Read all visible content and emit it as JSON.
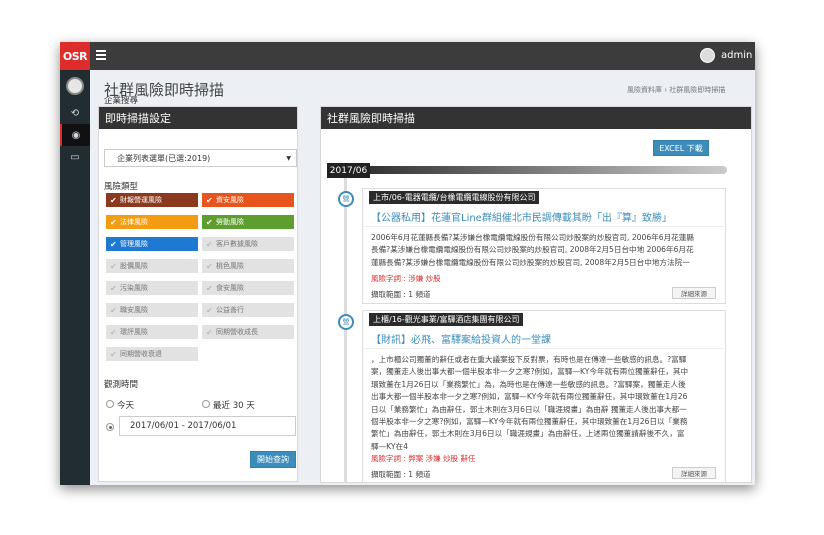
{
  "topbar": {
    "logo": "OSR",
    "user_name": "admin"
  },
  "page": {
    "title": "社群風險即時掃描",
    "breadcrumb": "風險資料庫 › 社群風險即時掃描"
  },
  "left_panel": {
    "header": "即時掃描設定",
    "company_label": "企業搜尋",
    "company_select": "企業列表選單(已選:2019)",
    "risk_type_label": "風險類型",
    "risk_types": [
      {
        "label": "財報營運風險",
        "on": true,
        "color": "#8b3a1f"
      },
      {
        "label": "資安風險",
        "on": true,
        "color": "#e8541d"
      },
      {
        "label": "法律風險",
        "on": true,
        "color": "#f39c12"
      },
      {
        "label": "勞動風險",
        "on": true,
        "color": "#5d9e2f"
      },
      {
        "label": "管理風險",
        "on": true,
        "color": "#1f78d1"
      },
      {
        "label": "客戶數據風險",
        "on": false,
        "color": "#e2e2e2"
      },
      {
        "label": "股價風險",
        "on": false,
        "color": "#e2e2e2"
      },
      {
        "label": "桃色風險",
        "on": false,
        "color": "#e2e2e2"
      },
      {
        "label": "污染風險",
        "on": false,
        "color": "#e2e2e2"
      },
      {
        "label": "食安風險",
        "on": false,
        "color": "#e2e2e2"
      },
      {
        "label": "職安風險",
        "on": false,
        "color": "#e2e2e2"
      },
      {
        "label": "公益善行",
        "on": false,
        "color": "#e2e2e2"
      },
      {
        "label": "環評風險",
        "on": false,
        "color": "#e2e2e2"
      },
      {
        "label": "同期營收成長",
        "on": false,
        "color": "#e2e2e2"
      },
      {
        "label": "同期營收衰退",
        "on": false,
        "color": "#e2e2e2"
      }
    ],
    "period_label": "觀測時間",
    "period_options": [
      {
        "label": "今天",
        "selected": false
      },
      {
        "label": "最近 30 天",
        "selected": false
      }
    ],
    "range_value": "2017/06/01 - 2017/06/01",
    "search_button": "開始查詢"
  },
  "right_panel": {
    "header": "社群風險即時掃描",
    "excel_button": "EXCEL 下載",
    "date_badge": "2017/06",
    "items": [
      {
        "icon_label": "營",
        "category": "上市/06-電器電纜/台橡電纜電線股份有限公司",
        "headline": "【公器私用】花蓮官Line群組催北市民調傳載其盼「出『算』致勝」",
        "body_lines": [
          "2006年6月花蓮縣長備?某涉嫌台橡電纜電線股份有限公司炒股案的炒股官司, 2006年6月花蓮縣",
          "長備?某涉嫌台橡電纜電線股份有限公司炒股案的炒股官司, 2008年2月5日台中地 2006年6月花",
          "蓮縣長備?某涉嫌台橡電纜電線股份有限公司炒股案的炒股官司, 2008年2月5日台中地方法院一"
        ],
        "keywords_label": "風險字詞 : 涉嫌 炒股",
        "range_label": "擷取範圍 : 1 頻道",
        "more_button": "詳細來源"
      },
      {
        "icon_label": "營",
        "category": "上櫃/16-觀光事業/富驛酒店集團有限公司",
        "headline": "【財訊】必飛、富驛案給投資人的一堂課",
        "body_lines": [
          "，上市櫃公司獨董的辭任或者在重大議案投下反對票，有時也是在傳達一些敏感的訊息。?富驛",
          "案，獨董走人後出事大都一個半股本非一夕之寒?例如，富驛—KY今年就有兩位獨董辭任，其中",
          "環致董在1月26日以「業務繁忙」為，為時也是在傳達一些敏感的訊息。?富驛案，獨董走人後",
          "出事大都一個半股本非一夕之寒?例如，富驛—KY今年就有兩位獨董辭任，其中環致董在1月26",
          "日以「業務繁忙」為由辭任，郭土木則在3月6日以「職涯規畫」為由辭 獨董走人後出事大都一",
          "個半股本非一夕之寒?例如，富驛—KY今年就有兩位獨董辭任，其中環致董在1月26日以「業務",
          "繁忙」為由辭任，郭土木則在3月6日以「職涯規畫」為由辭任，上述兩位獨董請辭後不久，富",
          "驛—KY在4"
        ],
        "keywords_label": "風險字詞 : 弊案 涉嫌 炒股 辭任",
        "range_label": "擷取範圍 : 1 頻道",
        "more_button": "詳細來源"
      }
    ]
  }
}
